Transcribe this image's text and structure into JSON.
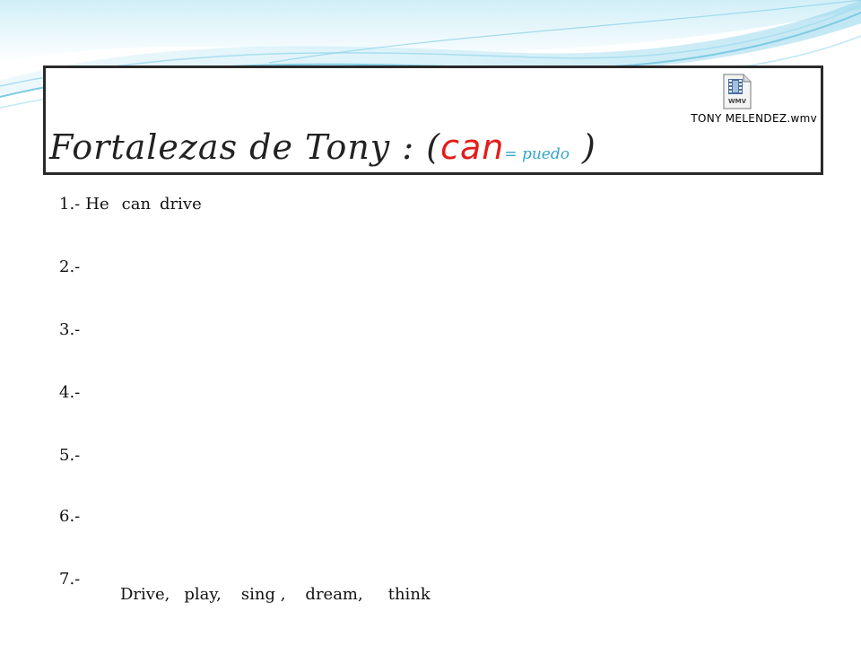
{
  "title": {
    "prefix": "Fortalezas de Tony : (",
    "can": "can",
    "translation": "= puedo",
    "suffix": ")"
  },
  "video_file": {
    "icon": "wmv-file-icon",
    "icon_text": "WMV",
    "filename": "TONY MELENDEZ.wmv"
  },
  "lines": [
    {
      "number": "1.-",
      "subject": "He",
      "modal": "can",
      "verb": "drive"
    },
    {
      "number": "2.-"
    },
    {
      "number": "3.-"
    },
    {
      "number": "4.-"
    },
    {
      "number": "5.-"
    },
    {
      "number": "6.-"
    },
    {
      "number": "7.-"
    }
  ],
  "verbs": [
    "Drive,",
    "play,",
    "sing ,",
    "dream,",
    "think"
  ],
  "colors": {
    "can": "#e41b1b",
    "translation": "#33a6c8",
    "wave": "#8fd3ea",
    "border": "#2a2a2a"
  }
}
